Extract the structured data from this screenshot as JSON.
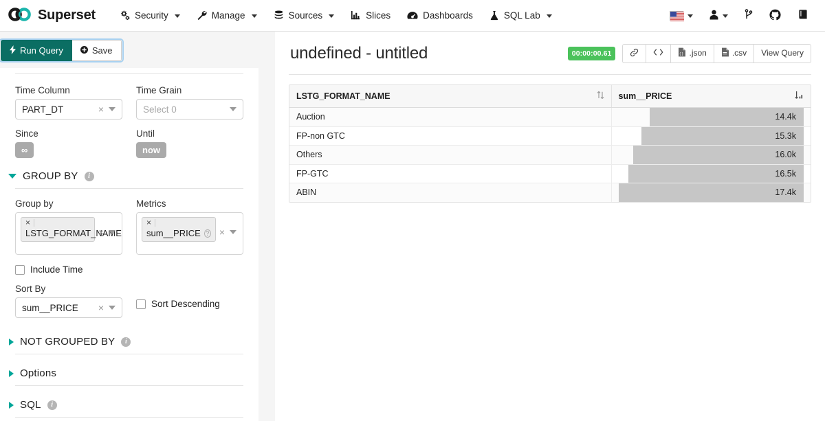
{
  "navbar": {
    "brand": "Superset",
    "brand_icon": "infinity-logo-icon",
    "items": [
      {
        "label": "Security",
        "icon": "gears-icon",
        "has_caret": true
      },
      {
        "label": "Manage",
        "icon": "wrench-icon",
        "has_caret": true
      },
      {
        "label": "Sources",
        "icon": "database-icon",
        "has_caret": true
      },
      {
        "label": "Slices",
        "icon": "bar-chart-icon",
        "has_caret": false
      },
      {
        "label": "Dashboards",
        "icon": "dashboard-gauge-icon",
        "has_caret": false
      },
      {
        "label": "SQL Lab",
        "icon": "flask-icon",
        "has_caret": true
      }
    ],
    "right_items": [
      {
        "name": "language-flag",
        "icon": "us-flag-icon",
        "has_caret": true
      },
      {
        "name": "user-menu",
        "icon": "user-icon",
        "has_caret": true
      },
      {
        "name": "version-branch",
        "icon": "code-branch-icon",
        "has_caret": false
      },
      {
        "name": "github-link",
        "icon": "github-icon",
        "has_caret": false
      },
      {
        "name": "documentation-link",
        "icon": "book-icon",
        "has_caret": false
      }
    ]
  },
  "query_bar": {
    "run_label": "Run Query",
    "run_icon": "lightning-bolt-icon",
    "save_label": "Save",
    "save_icon": "plus-circle-icon"
  },
  "controls": {
    "time_column": {
      "label": "Time Column",
      "value": "PART_DT",
      "clear_icon": "clear-x-icon",
      "caret_icon": "chevron-down-icon"
    },
    "time_grain": {
      "label": "Time Grain",
      "placeholder": "Select 0",
      "value": "",
      "caret_icon": "chevron-down-icon"
    },
    "since": {
      "label": "Since",
      "value": "∞"
    },
    "until": {
      "label": "Until",
      "value": "now"
    },
    "group_by_section": {
      "title": "GROUP BY",
      "expanded": true,
      "info_icon": "info-icon"
    },
    "group_by": {
      "label": "Group by",
      "tags": [
        "LSTG_FORMAT_NAME"
      ],
      "remove_icon": "remove-x-icon",
      "clear_icon": "clear-x-icon",
      "caret_icon": "chevron-down-icon"
    },
    "metrics": {
      "label": "Metrics",
      "tags": [
        "sum__PRICE"
      ],
      "tag_help_icon": "question-circle-icon",
      "remove_icon": "remove-x-icon",
      "clear_icon": "clear-x-icon",
      "caret_icon": "chevron-down-icon"
    },
    "include_time": {
      "label": "Include Time",
      "checked": false
    },
    "sort_by": {
      "label": "Sort By",
      "value": "sum__PRICE",
      "clear_icon": "clear-x-icon",
      "caret_icon": "chevron-down-icon"
    },
    "sort_descending": {
      "label": "Sort Descending",
      "checked": false
    },
    "sections": [
      {
        "title": "NOT GROUPED BY",
        "info_icon": "info-icon",
        "expanded": false
      },
      {
        "title": "Options",
        "info_icon": "",
        "expanded": false
      },
      {
        "title": "SQL",
        "info_icon": "info-icon",
        "expanded": false
      }
    ]
  },
  "chart_panel": {
    "title": "undefined - untitled",
    "timer": "00:00:00.61",
    "tools": [
      {
        "label": "",
        "icon": "link-chain-icon"
      },
      {
        "label": "",
        "icon": "embed-code-icon"
      },
      {
        "label": ".json",
        "icon": "file-json-icon"
      },
      {
        "label": ".csv",
        "icon": "file-csv-icon"
      },
      {
        "label": "View Query",
        "icon": ""
      }
    ]
  },
  "chart_data": {
    "type": "table",
    "title": "undefined - untitled",
    "columns": [
      {
        "key": "LSTG_FORMAT_NAME",
        "label": "LSTG_FORMAT_NAME",
        "sort": "none",
        "sort_icon": "sort-both-icon"
      },
      {
        "key": "sum__PRICE",
        "label": "sum__PRICE",
        "sort": "asc",
        "sort_icon": "sort-amount-asc-icon"
      }
    ],
    "categories": [
      "Auction",
      "FP-non GTC",
      "Others",
      "FP-GTC",
      "ABIN"
    ],
    "values": [
      14400,
      15300,
      16000,
      16500,
      17400
    ],
    "value_labels": [
      "14.4k",
      "15.3k",
      "16.0k",
      "16.5k",
      "17.4k"
    ],
    "bar_fractions": [
      0.83,
      0.875,
      0.92,
      0.945,
      1.0
    ],
    "xlabel": "",
    "ylabel": "sum__PRICE",
    "bar_color": "#c6c6c6",
    "rows": [
      {
        "LSTG_FORMAT_NAME": "Auction",
        "sum__PRICE": "14.4k",
        "fraction": 0.83
      },
      {
        "LSTG_FORMAT_NAME": "FP-non GTC",
        "sum__PRICE": "15.3k",
        "fraction": 0.875
      },
      {
        "LSTG_FORMAT_NAME": "Others",
        "sum__PRICE": "16.0k",
        "fraction": 0.92
      },
      {
        "LSTG_FORMAT_NAME": "FP-GTC",
        "sum__PRICE": "16.5k",
        "fraction": 0.945
      },
      {
        "LSTG_FORMAT_NAME": "ABIN",
        "sum__PRICE": "17.4k",
        "fraction": 1.0
      }
    ]
  },
  "colors": {
    "run_button": "#0b6e63",
    "accent_teal": "#00a699",
    "timer_green": "#4bc25b",
    "bar_gray": "#c6c6c6",
    "badge_gray": "#aaaaaa"
  }
}
